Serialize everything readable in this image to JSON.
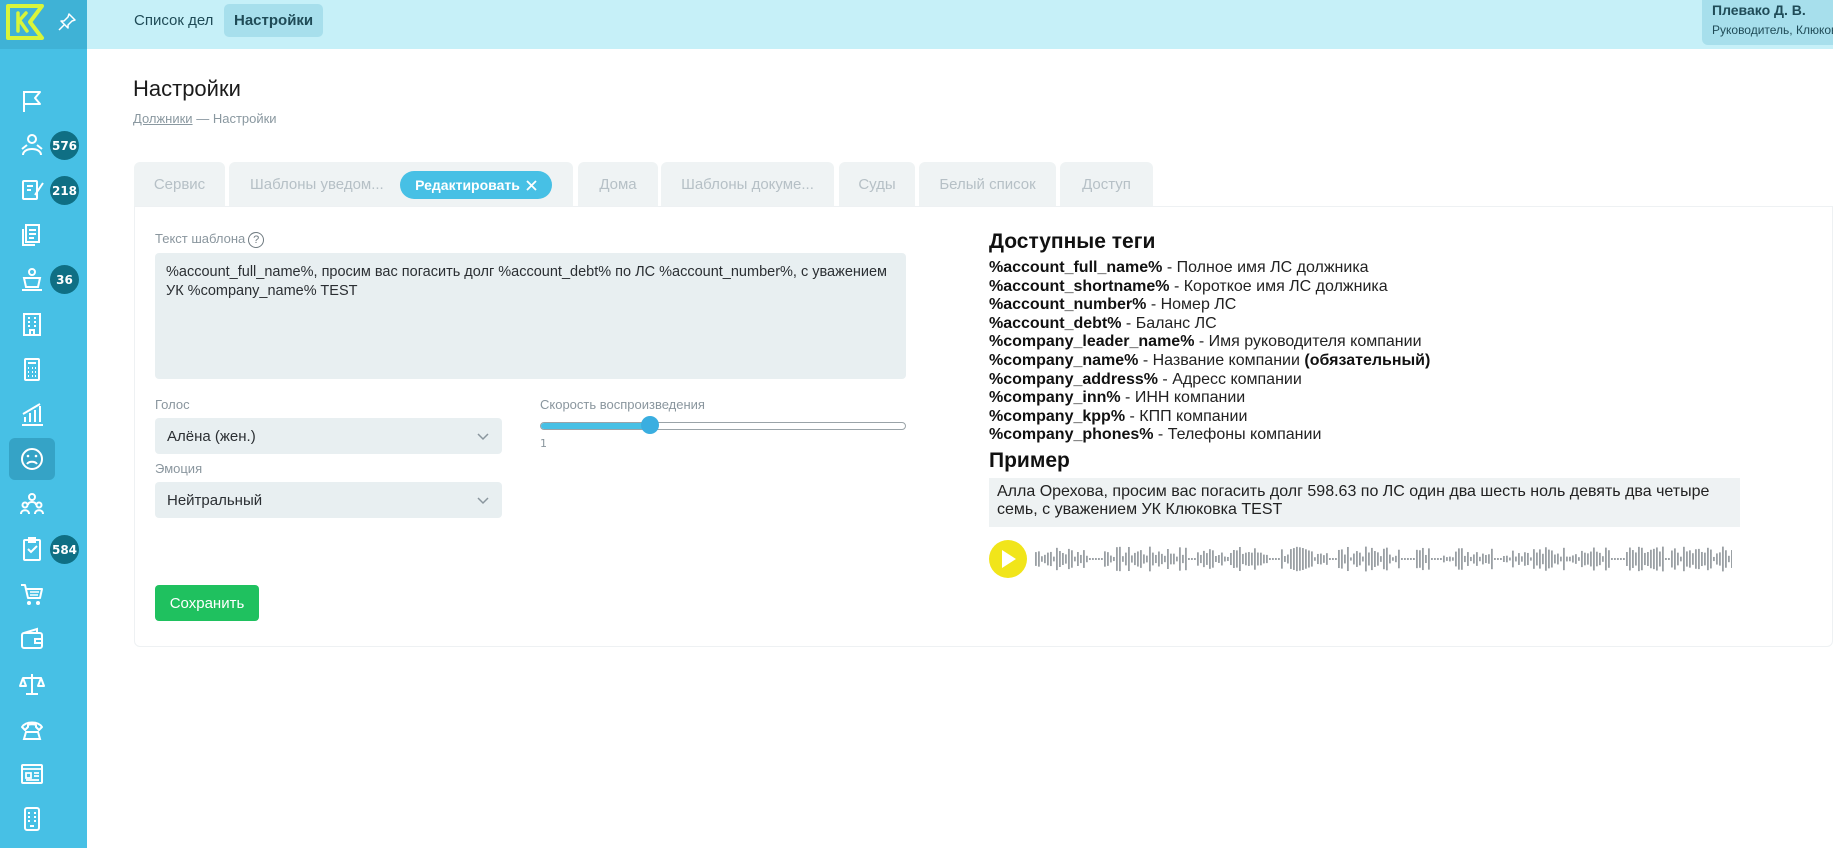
{
  "topbar": {
    "links": [
      {
        "label": "Список дел",
        "active": false
      },
      {
        "label": "Настройки",
        "active": true
      }
    ],
    "user": {
      "name": "Плевако Д. В.",
      "role": "Руководитель, Клюковка"
    }
  },
  "sidebar": {
    "badges": {
      "debtors": "576",
      "tasks": "218",
      "courts": "36",
      "checks": "584"
    },
    "icons": [
      "flag-icon",
      "debtors-icon",
      "edit-doc-icon",
      "docs-icon",
      "court-icon",
      "building-icon",
      "calculator-icon",
      "chart-icon",
      "sad-face-icon",
      "people-icon",
      "checklist-icon",
      "cart-icon",
      "wallet-icon",
      "scales-icon",
      "phone-icon",
      "news-icon",
      "mobile-icon"
    ]
  },
  "page": {
    "title": "Настройки",
    "breadcrumb_link": "Должники",
    "breadcrumb_sep": "—",
    "breadcrumb_current": "Настройки"
  },
  "tabs": [
    "Сервис",
    "Шаблоны уведом...",
    "Редактировать",
    "Дома",
    "Шаблоны докуме...",
    "Суды",
    "Белый список",
    "Доступ"
  ],
  "form": {
    "template_label": "Текст шаблона",
    "help_glyph": "?",
    "template_text": "%account_full_name%, просим вас погасить долг %account_debt% по ЛС %account_number%, с уважением УК %company_name% TEST",
    "voice_label": "Голос",
    "voice_value": "Алёна (жен.)",
    "emotion_label": "Эмоция",
    "emotion_value": "Нейтральный",
    "speed_label": "Скорость воспроизведения",
    "speed_value": "1",
    "speed_fraction": 0.3,
    "save_label": "Сохранить"
  },
  "tags": {
    "title": "Доступные теги",
    "items": [
      {
        "tag": "%account_full_name%",
        "desc": " - Полное имя ЛС должника"
      },
      {
        "tag": "%account_shortname%",
        "desc": " - Короткое имя ЛС должника"
      },
      {
        "tag": "%account_number%",
        "desc": " - Номер ЛС"
      },
      {
        "tag": "%account_debt%",
        "desc": " - Баланс ЛС"
      },
      {
        "tag": "%company_leader_name%",
        "desc": " - Имя руководителя компании"
      },
      {
        "tag": "%company_name%",
        "desc": " - Название компании ",
        "extra": "(обязательный)"
      },
      {
        "tag": "%company_address%",
        "desc": " - Адресс компании"
      },
      {
        "tag": "%company_inn%",
        "desc": " - ИНН компании"
      },
      {
        "tag": "%company_kpp%",
        "desc": " - КПП компании"
      },
      {
        "tag": "%company_phones%",
        "desc": " - Телефоны компании"
      }
    ]
  },
  "example": {
    "title": "Пример",
    "text": "Алла Орехова, просим вас погасить долг 598.63 по ЛС один два шесть ноль девять два четыре семь, с уважением УК Клюковка TEST"
  },
  "colors": {
    "brand": "#47c0e5",
    "save": "#1fc15f",
    "play": "#f1e51a",
    "logo": "#d8f53a"
  }
}
